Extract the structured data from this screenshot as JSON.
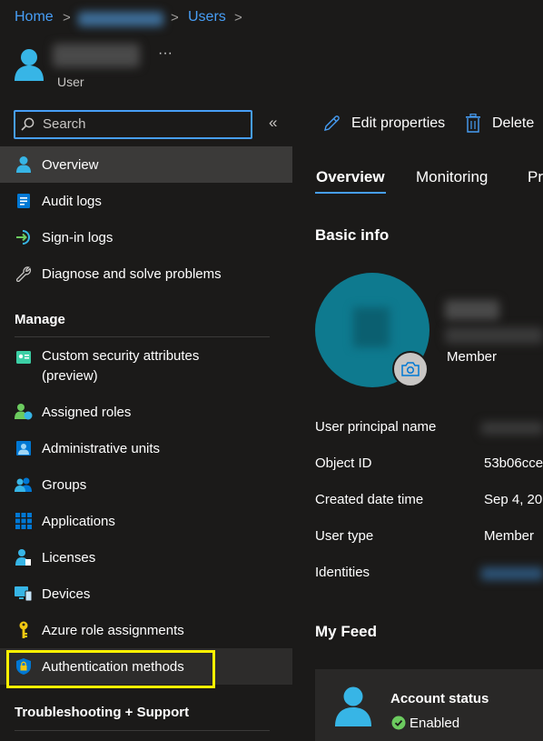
{
  "breadcrumb": {
    "home": "Home",
    "users": "Users",
    "sep": ">"
  },
  "header": {
    "subtitle": "User",
    "more": "···"
  },
  "search": {
    "placeholder": "Search",
    "collapse": "«"
  },
  "toolbar": {
    "edit": "Edit properties",
    "delete": "Delete"
  },
  "nav": {
    "top": [
      {
        "label": "Overview",
        "icon": "user-icon"
      },
      {
        "label": "Audit logs",
        "icon": "audit-log-icon"
      },
      {
        "label": "Sign-in logs",
        "icon": "sign-in-icon"
      },
      {
        "label": "Diagnose and solve problems",
        "icon": "wrench-icon"
      }
    ],
    "manage_heading": "Manage",
    "manage": [
      {
        "label": "Custom security attributes",
        "label2": "(preview)",
        "icon": "security-attributes-icon"
      },
      {
        "label": "Assigned roles",
        "icon": "assigned-roles-icon"
      },
      {
        "label": "Administrative units",
        "icon": "admin-units-icon"
      },
      {
        "label": "Groups",
        "icon": "groups-icon"
      },
      {
        "label": "Applications",
        "icon": "applications-icon"
      },
      {
        "label": "Licenses",
        "icon": "licenses-icon"
      },
      {
        "label": "Devices",
        "icon": "devices-icon"
      },
      {
        "label": "Azure role assignments",
        "icon": "key-icon"
      },
      {
        "label": "Authentication methods",
        "icon": "shield-icon"
      }
    ],
    "support_heading": "Troubleshooting + Support"
  },
  "tabs": [
    "Overview",
    "Monitoring",
    "Pr"
  ],
  "basic_info": {
    "heading": "Basic info",
    "member": "Member",
    "props": [
      {
        "label": "User principal name",
        "value": ""
      },
      {
        "label": "Object ID",
        "value": "53b06cce"
      },
      {
        "label": "Created date time",
        "value": "Sep 4, 20"
      },
      {
        "label": "User type",
        "value": "Member"
      },
      {
        "label": "Identities",
        "value": ""
      }
    ]
  },
  "feed": {
    "heading": "My Feed",
    "card_title": "Account status",
    "card_status": "Enabled"
  },
  "colors": {
    "accent": "#479ef5",
    "highlight": "#fff100",
    "avatar": "#0e7a8f",
    "success": "#6ccb5f"
  }
}
